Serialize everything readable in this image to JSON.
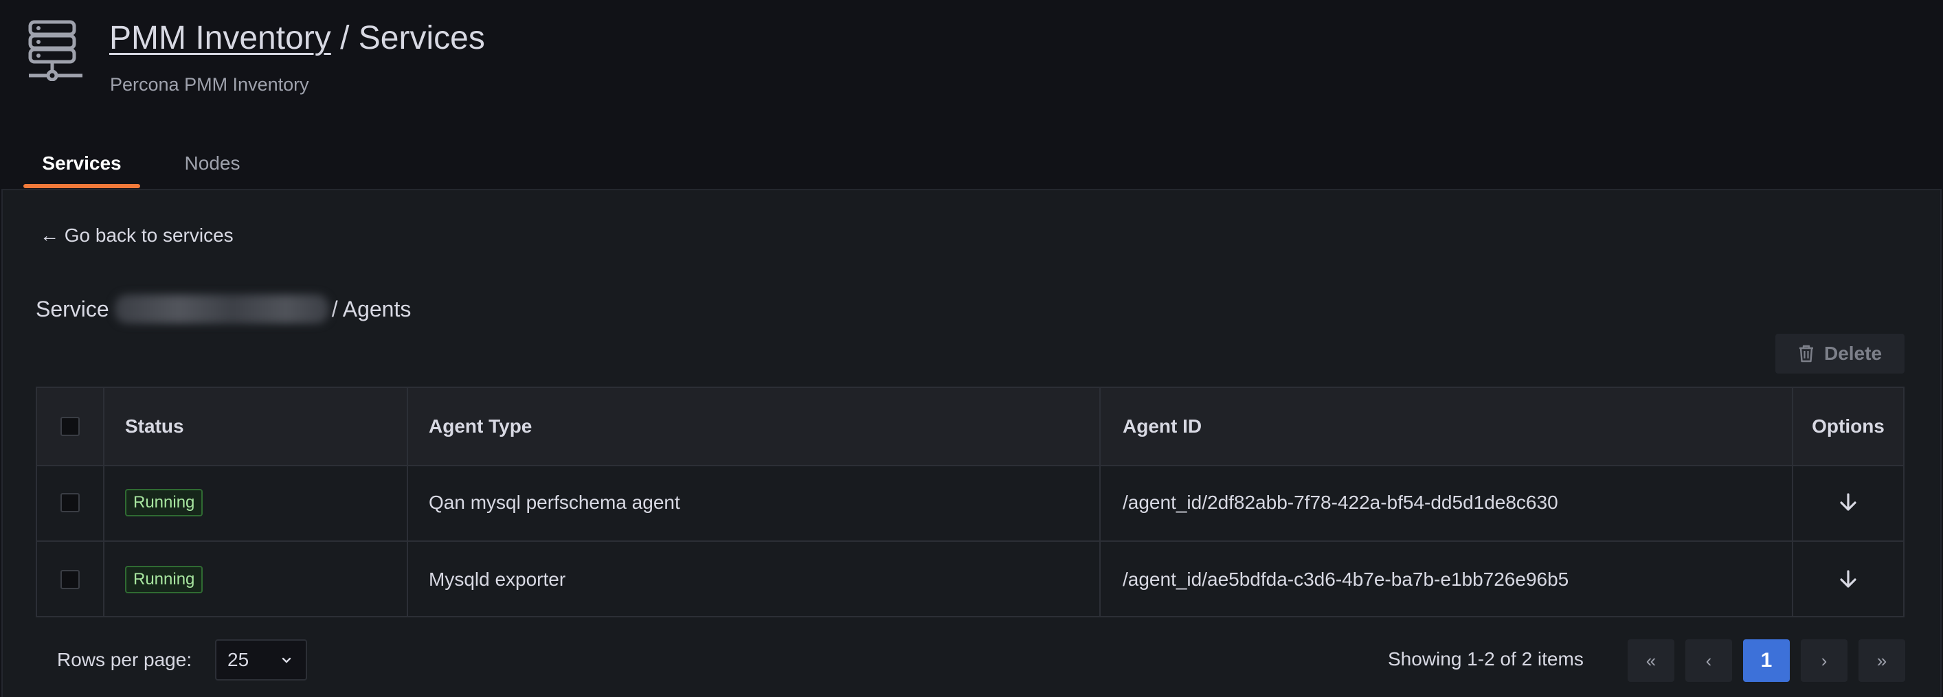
{
  "header": {
    "breadcrumb_link": "PMM Inventory",
    "separator": " / ",
    "page_name": "Services",
    "subtitle": "Percona PMM Inventory"
  },
  "tabs": [
    {
      "label": "Services",
      "active": true
    },
    {
      "label": "Nodes",
      "active": false
    }
  ],
  "back_link": "← Go back to services",
  "service_title": {
    "prefix": "Service",
    "suffix": "/ Agents"
  },
  "toolbar": {
    "delete_label": "Delete"
  },
  "table": {
    "columns": [
      "Status",
      "Agent Type",
      "Agent ID",
      "Options"
    ],
    "rows": [
      {
        "status": "Running",
        "agent_type": "Qan mysql perfschema agent",
        "agent_id": "/agent_id/2df82abb-7f78-422a-bf54-dd5d1de8c630"
      },
      {
        "status": "Running",
        "agent_type": "Mysqld exporter",
        "agent_id": "/agent_id/ae5bdfda-c3d6-4b7e-ba7b-e1bb726e96b5"
      }
    ]
  },
  "pagination": {
    "rows_per_page_label": "Rows per page:",
    "rows_per_page_value": "25",
    "showing_text": "Showing 1-2 of 2 items",
    "first": "«",
    "prev": "‹",
    "current_page": "1",
    "next": "›",
    "last": "»"
  },
  "colors": {
    "accent_tab": "#f0793a",
    "primary_button": "#3d71d9",
    "status_running": "#a8e6a0"
  }
}
